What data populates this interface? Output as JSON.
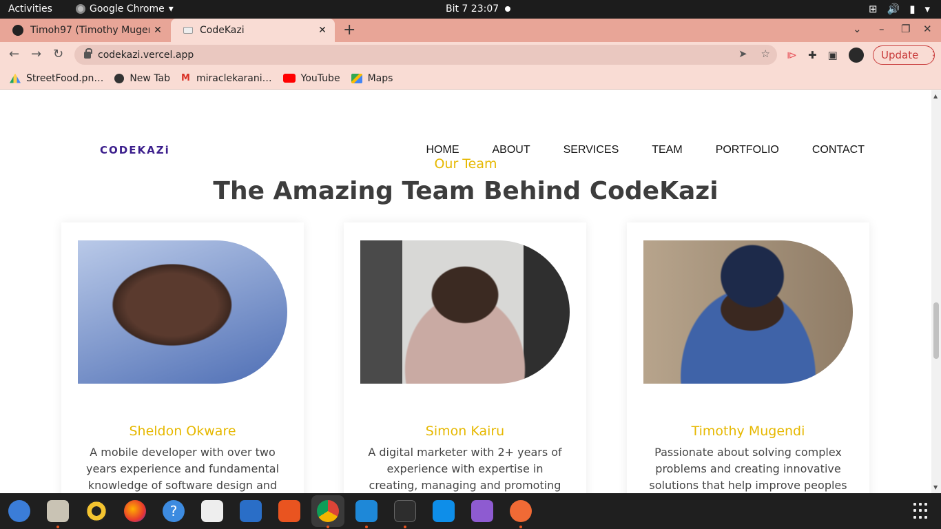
{
  "topbar": {
    "activities": "Activities",
    "app_name": "Google Chrome",
    "clock": "Bit 7  23:07"
  },
  "tabs": [
    {
      "title": "Timoh97 (Timothy Mugen",
      "close": "✕"
    },
    {
      "title": "CodeKazi",
      "close": "✕"
    }
  ],
  "toolbar": {
    "url": "codekazi.vercel.app",
    "update_label": "Update"
  },
  "bookmarks": [
    {
      "label": "StreetFood.pn…",
      "icon": "google-drive-icon"
    },
    {
      "label": "New Tab",
      "icon": "globe-icon"
    },
    {
      "label": "miraclekarani…",
      "icon": "gmail-icon"
    },
    {
      "label": "YouTube",
      "icon": "youtube-icon"
    },
    {
      "label": "Maps",
      "icon": "maps-icon"
    }
  ],
  "site": {
    "logo": "CODEKAZi",
    "nav": [
      "HOME",
      "ABOUT",
      "SERVICES",
      "TEAM",
      "PORTFOLIO",
      "CONTACT"
    ],
    "subtitle": "Our Team",
    "headline": "The Amazing Team Behind CodeKazi",
    "team": [
      {
        "name": "Sheldon Okware",
        "bio": "A mobile developer with over two years experience and fundamental knowledge of software design and"
      },
      {
        "name": "Simon Kairu",
        "bio": "A digital marketer with 2+ years of experience with expertise in creating, managing and promoting online"
      },
      {
        "name": "Timothy Mugendi",
        "bio": "Passionate about solving complex problems and creating innovative solutions that help improve peoples"
      }
    ]
  },
  "colors": {
    "accent": "#e6b800",
    "tab_strip": "#e8a597",
    "toolbar": "#f9dcd4",
    "update": "#c83a3a",
    "logo": "#3b1e8c"
  }
}
